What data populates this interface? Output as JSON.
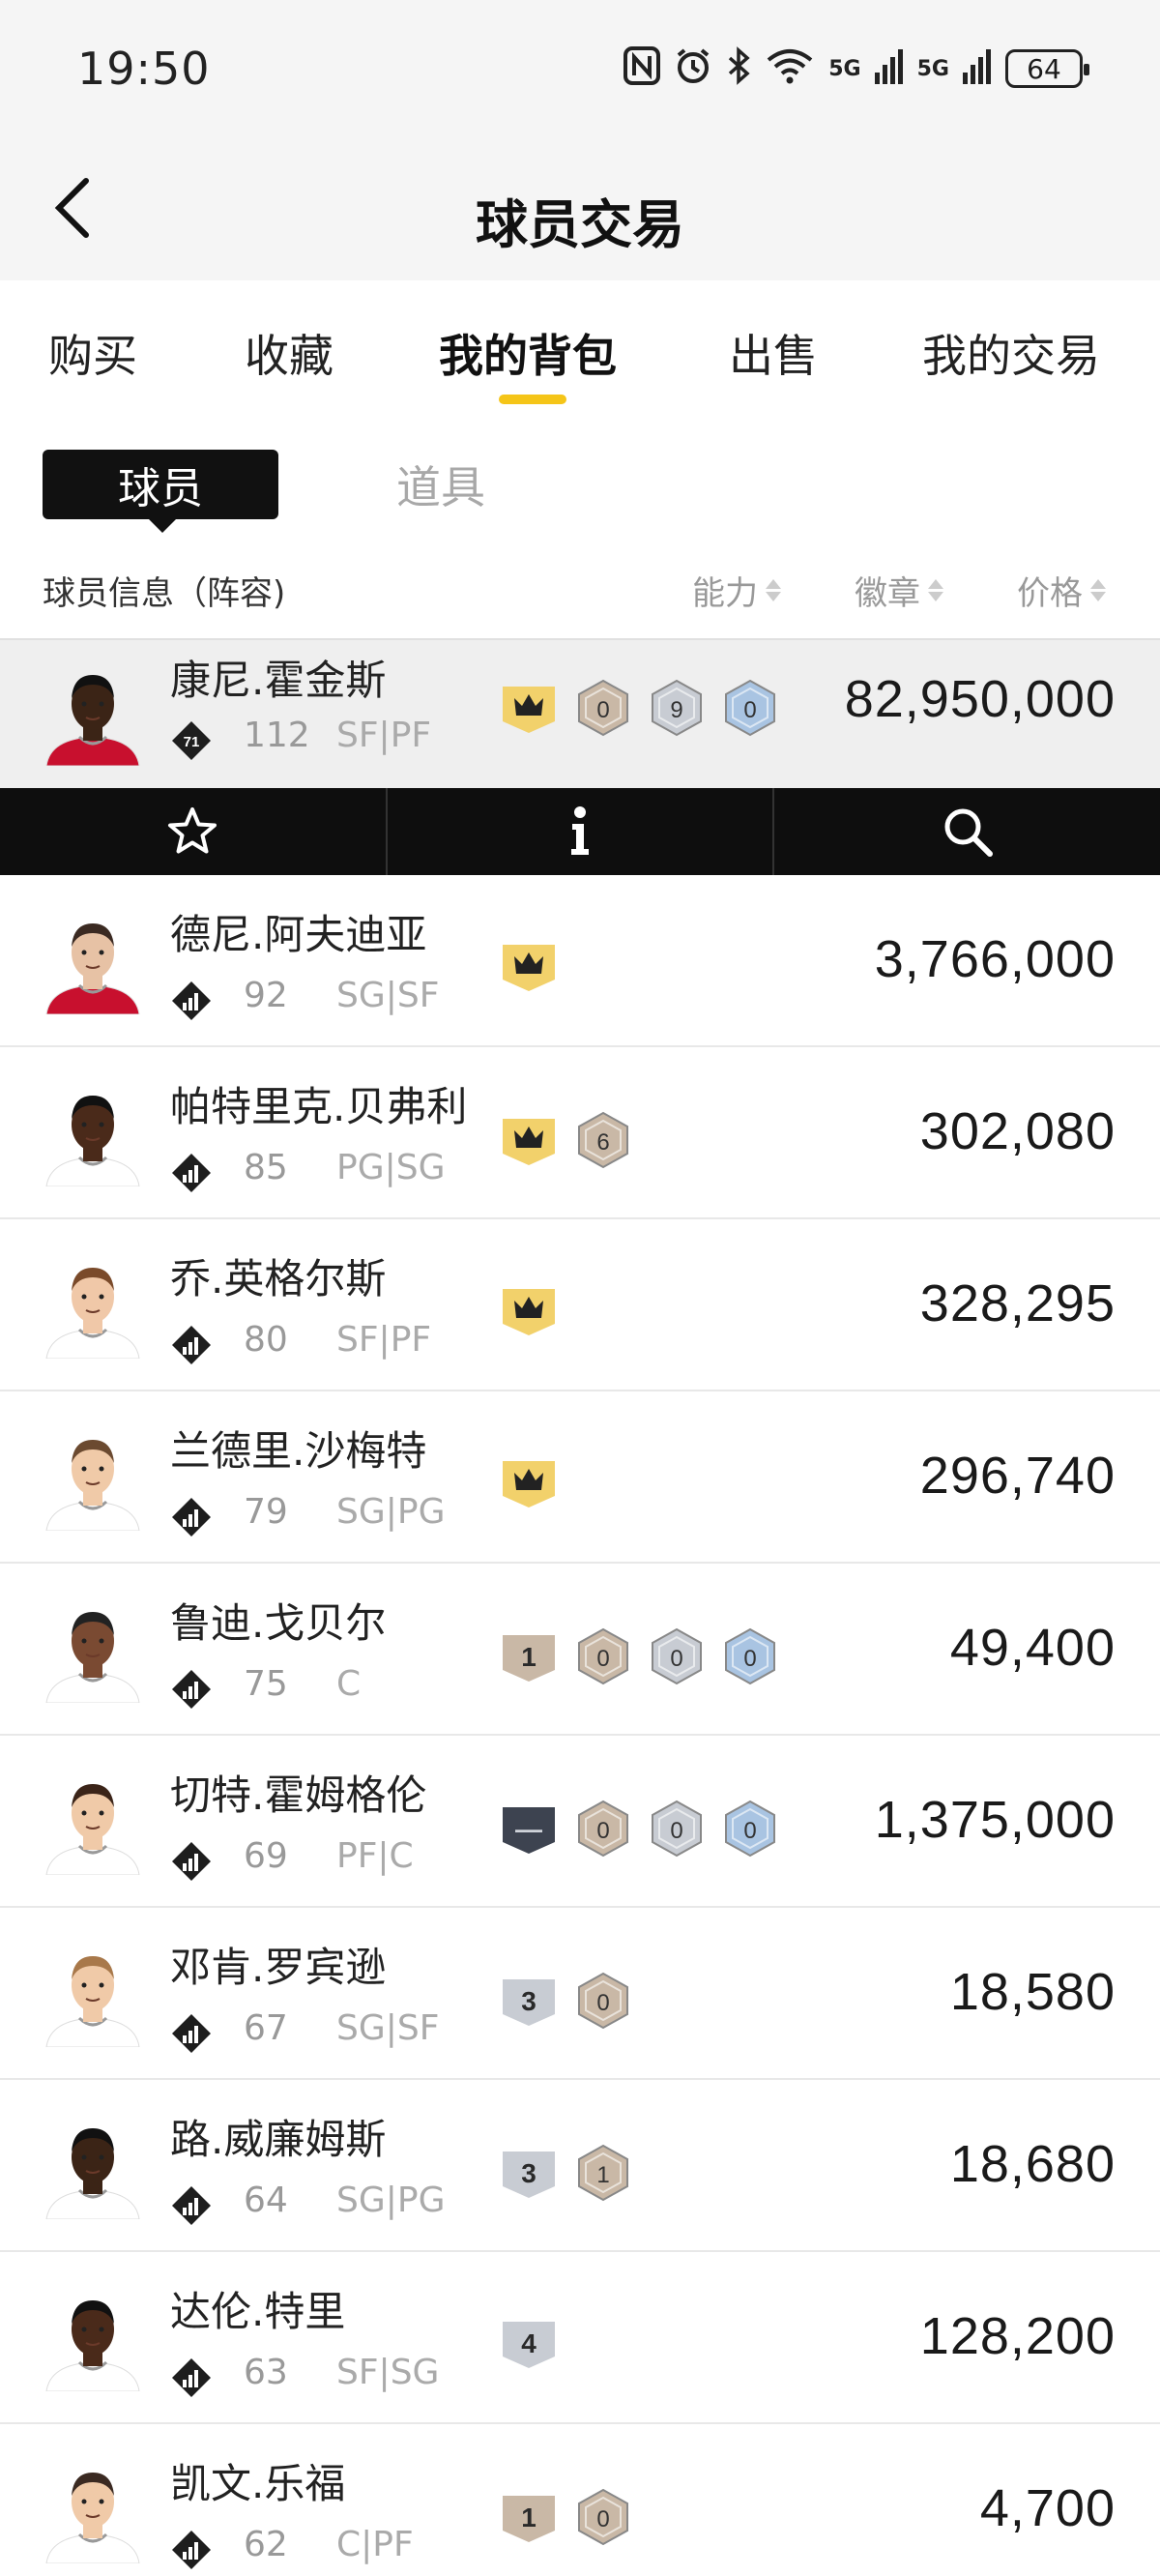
{
  "status": {
    "time": "19:50",
    "battery": "64",
    "signal1": "5G",
    "signal2": "5G"
  },
  "header": {
    "title": "球员交易"
  },
  "tabs": [
    {
      "label": "购买"
    },
    {
      "label": "收藏"
    },
    {
      "label": "我的背包",
      "active": true
    },
    {
      "label": "出售"
    },
    {
      "label": "我的交易"
    }
  ],
  "sub_tabs": {
    "active": "球员",
    "other": "道具"
  },
  "columns": {
    "player": "球员信息（阵容)",
    "ability": "能力",
    "badge": "徽章",
    "price": "价格"
  },
  "colors": {
    "accent": "#f5c518",
    "dark": "#111111",
    "highlight_row": "#efefef"
  },
  "rows": [
    {
      "name": "康尼.霍金斯",
      "tier": "71",
      "ovr": "112",
      "pos": "SF|PF",
      "price": "82,950,000",
      "skin": "#3b2416",
      "hair": "#111",
      "jersey": "#c8102e",
      "badges": [
        {
          "type": "crown",
          "color": "#f2d16b"
        },
        {
          "type": "hex",
          "label": "0",
          "color": "#c9b8a6"
        },
        {
          "type": "hex",
          "label": "9",
          "color": "#c8ccd3"
        },
        {
          "type": "hex",
          "label": "0",
          "color": "#a9c4e2"
        }
      ]
    },
    {
      "name": "德尼.阿夫迪亚",
      "tier": "",
      "ovr": "92",
      "pos": "SG|SF",
      "price": "3,766,000",
      "skin": "#e7c2a5",
      "hair": "#3b2a22",
      "jersey": "#c8102e",
      "badges": [
        {
          "type": "crown",
          "color": "#f2d16b"
        }
      ]
    },
    {
      "name": "帕特里克.贝弗利",
      "tier": "",
      "ovr": "85",
      "pos": "PG|SG",
      "price": "302,080",
      "skin": "#4a2a1a",
      "hair": "#111",
      "jersey": "#ffffff",
      "badges": [
        {
          "type": "crown",
          "color": "#f2d16b"
        },
        {
          "type": "hex",
          "label": "6",
          "color": "#c9b8a6"
        }
      ]
    },
    {
      "name": "乔.英格尔斯",
      "tier": "",
      "ovr": "80",
      "pos": "SF|PF",
      "price": "328,295",
      "skin": "#f0c8a8",
      "hair": "#7a4a2a",
      "jersey": "#ffffff",
      "badges": [
        {
          "type": "crown",
          "color": "#f2d16b"
        }
      ]
    },
    {
      "name": "兰德里.沙梅特",
      "tier": "",
      "ovr": "79",
      "pos": "SG|PG",
      "price": "296,740",
      "skin": "#f0caa8",
      "hair": "#6b4a30",
      "jersey": "#ffffff",
      "badges": [
        {
          "type": "crown",
          "color": "#f2d16b"
        }
      ]
    },
    {
      "name": "鲁迪.戈贝尔",
      "tier": "",
      "ovr": "75",
      "pos": "C",
      "price": "49,400",
      "skin": "#7a4a32",
      "hair": "#222",
      "jersey": "#ffffff",
      "badges": [
        {
          "type": "shield",
          "label": "1",
          "color": "#c9b8a6"
        },
        {
          "type": "hex",
          "label": "0",
          "color": "#c9b8a6"
        },
        {
          "type": "hex",
          "label": "0",
          "color": "#c8ccd3"
        },
        {
          "type": "hex",
          "label": "0",
          "color": "#a9c4e2"
        }
      ]
    },
    {
      "name": "切特.霍姆格伦",
      "tier": "",
      "ovr": "69",
      "pos": "PF|C",
      "price": "1,375,000",
      "skin": "#f0caa8",
      "hair": "#3b2418",
      "jersey": "#ffffff",
      "badges": [
        {
          "type": "shield",
          "label": "—",
          "color": "#3d4350"
        },
        {
          "type": "hex",
          "label": "0",
          "color": "#c9b8a6"
        },
        {
          "type": "hex",
          "label": "0",
          "color": "#c8ccd3"
        },
        {
          "type": "hex",
          "label": "0",
          "color": "#a9c4e2"
        }
      ]
    },
    {
      "name": "邓肯.罗宾逊",
      "tier": "",
      "ovr": "67",
      "pos": "SG|SF",
      "price": "18,580",
      "skin": "#f0caa8",
      "hair": "#a8784a",
      "jersey": "#ffffff",
      "badges": [
        {
          "type": "shield",
          "label": "3",
          "color": "#c8ccd3"
        },
        {
          "type": "hex",
          "label": "0",
          "color": "#c9b8a6"
        }
      ]
    },
    {
      "name": "路.威廉姆斯",
      "tier": "",
      "ovr": "64",
      "pos": "SG|PG",
      "price": "18,680",
      "skin": "#3b2416",
      "hair": "#111",
      "jersey": "#ffffff",
      "badges": [
        {
          "type": "shield",
          "label": "3",
          "color": "#c8ccd3"
        },
        {
          "type": "hex",
          "label": "1",
          "color": "#c9b8a6"
        }
      ]
    },
    {
      "name": "达伦.特里",
      "tier": "",
      "ovr": "63",
      "pos": "SF|SG",
      "price": "128,200",
      "skin": "#4a2a1a",
      "hair": "#111",
      "jersey": "#ffffff",
      "badges": [
        {
          "type": "shield",
          "label": "4",
          "color": "#c8ccd3"
        }
      ]
    },
    {
      "name": "凯文.乐福",
      "tier": "",
      "ovr": "62",
      "pos": "C|PF",
      "price": "4,700",
      "skin": "#f0caa8",
      "hair": "#3b2a22",
      "jersey": "#ffffff",
      "badges": [
        {
          "type": "shield",
          "label": "1",
          "color": "#c9b8a6"
        },
        {
          "type": "hex",
          "label": "0",
          "color": "#c9b8a6"
        }
      ]
    }
  ],
  "actions": [
    {
      "name": "favorite",
      "icon": "star-icon"
    },
    {
      "name": "info",
      "icon": "info-icon"
    },
    {
      "name": "search",
      "icon": "search-icon"
    }
  ]
}
